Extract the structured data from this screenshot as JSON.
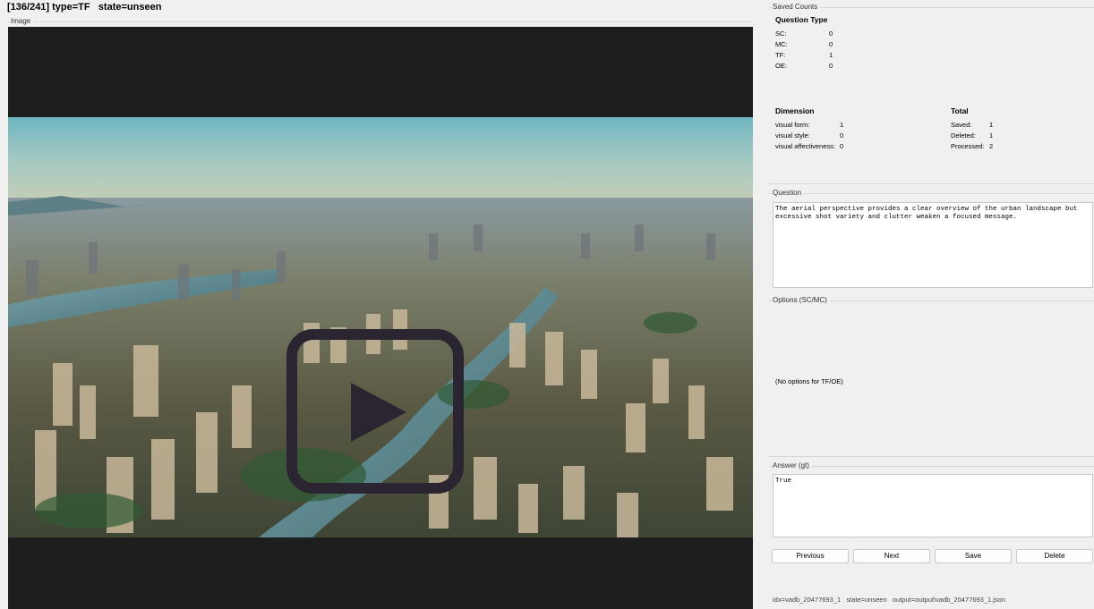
{
  "header": {
    "title": "[136/241] type=TF   state=unseen"
  },
  "image_group": {
    "label": "Image"
  },
  "saved_counts": {
    "label": "Saved Counts",
    "question_type": {
      "heading": "Question Type",
      "rows": [
        {
          "key": "SC:",
          "value": "0"
        },
        {
          "key": "MC:",
          "value": "0"
        },
        {
          "key": "TF:",
          "value": "1"
        },
        {
          "key": "OE:",
          "value": "0"
        }
      ]
    },
    "dimension": {
      "heading": "Dimension",
      "rows": [
        {
          "key": "visual form:",
          "value": "1"
        },
        {
          "key": "visual style:",
          "value": "0"
        },
        {
          "key": "visual affectiveness:",
          "value": "0"
        }
      ]
    },
    "total": {
      "heading": "Total",
      "rows": [
        {
          "key": "Saved:",
          "value": "1"
        },
        {
          "key": "Deleted:",
          "value": "1"
        },
        {
          "key": "Processed:",
          "value": "2"
        }
      ]
    }
  },
  "question": {
    "label": "Question",
    "text": "The aerial perspective provides a clear overview of the urban landscape but\nexcessive shot variety and clutter weaken a focused message."
  },
  "options": {
    "label": "Options (SC/MC)",
    "empty_text": "(No options for TF/OE)"
  },
  "answer": {
    "label": "Answer (gt)",
    "text": "True"
  },
  "buttons": {
    "previous": "Previous",
    "next": "Next",
    "save": "Save",
    "delete": "Delete"
  },
  "status": {
    "text": "idx=vadb_20477693_1   state=unseen   output=output\\vadb_20477693_1.json"
  }
}
